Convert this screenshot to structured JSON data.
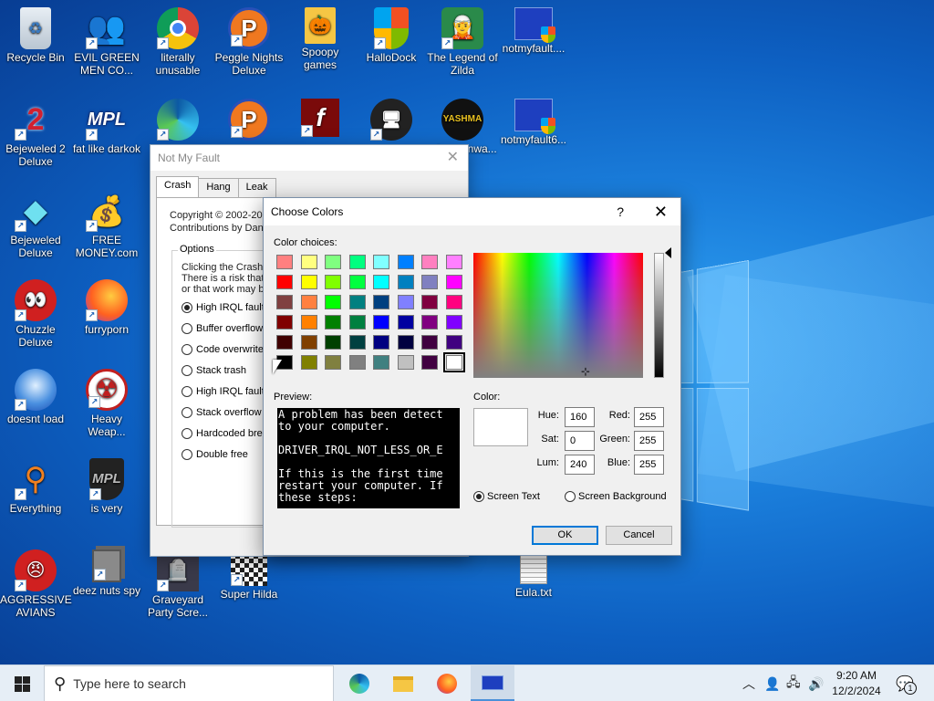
{
  "desktop": {
    "icons": [
      {
        "label": "Recycle Bin",
        "icon": "recycle-bin-icon"
      },
      {
        "label": "EVIL GREEN MEN CO...",
        "icon": "green-men-icon"
      },
      {
        "label": "literally unusable",
        "icon": "chrome-icon"
      },
      {
        "label": "Peggle Nights Deluxe",
        "icon": "peggle-icon"
      },
      {
        "label": "Spoopy games",
        "icon": "folder-icon"
      },
      {
        "label": "HalloDock",
        "icon": "shield-icon"
      },
      {
        "label": "The Legend of Zilda",
        "icon": "zelda-icon"
      },
      {
        "label": "notmyfault....",
        "icon": "notmyfault-icon"
      },
      {
        "label": "Bejeweled 2 Deluxe",
        "icon": "bejeweled2-icon"
      },
      {
        "label": "fat like darkok",
        "icon": "mpl-icon"
      },
      {
        "label": "",
        "icon": "edge-icon"
      },
      {
        "label": "",
        "icon": "peggle2-icon"
      },
      {
        "label": "",
        "icon": "flash-icon"
      },
      {
        "label": "",
        "icon": "hallodock2-icon"
      },
      {
        "label": "...boo ...nwa...",
        "icon": "yashma-icon"
      },
      {
        "label": "notmyfault6...",
        "icon": "notmyfault2-icon"
      },
      {
        "label": "Bejeweled Deluxe",
        "icon": "diamond-icon"
      },
      {
        "label": "FREE MONEY.com",
        "icon": "money-bag-icon"
      },
      {
        "label": "Chuzzle Deluxe",
        "icon": "chuzzle-icon"
      },
      {
        "label": "furryporn",
        "icon": "firefox-icon"
      },
      {
        "label": "doesnt load",
        "icon": "thunderbird-icon"
      },
      {
        "label": "Heavy Weap...",
        "icon": "radiation-icon"
      },
      {
        "label": "Everything",
        "icon": "everything-icon"
      },
      {
        "label": "is very",
        "icon": "mpl2-icon"
      },
      {
        "label": "AGGRESSIVE AVIANS",
        "icon": "angry-bird-icon"
      },
      {
        "label": "deez nuts spy",
        "icon": "cards-icon"
      },
      {
        "label": "Graveyard Party Scre...",
        "icon": "graveyard-icon"
      },
      {
        "label": "Super Hilda",
        "icon": "pixel-icon"
      },
      {
        "label": "Eula.txt",
        "icon": "text-file-icon"
      }
    ]
  },
  "notmyfault": {
    "title": "Not My Fault",
    "tabs": [
      "Crash",
      "Hang",
      "Leak"
    ],
    "copyright": "Copyright © 2002-20",
    "contributions": "Contributions by Dani",
    "options_legend": "Options",
    "desc": [
      "Clicking the Crash b",
      "There is a risk that c",
      "or that work may be"
    ],
    "radios": [
      "High IRQL fault (",
      "Buffer overflow",
      "Code overwrite",
      "Stack trash",
      "High IRQL fault (",
      "Stack overflow",
      "Hardcoded breal",
      "Double free"
    ]
  },
  "choose_colors": {
    "title": "Choose Colors",
    "help": "?",
    "color_choices_label": "Color choices:",
    "preview_label": "Preview:",
    "preview_text": "A problem has been detect\nto your computer.\n\nDRIVER_IRQL_NOT_LESS_OR_E\n\nIf this is the first time\nrestart your computer. If\nthese steps:",
    "color_label": "Color:",
    "hue_label": "Hue:",
    "hue": "160",
    "sat_label": "Sat:",
    "sat": "0",
    "lum_label": "Lum:",
    "lum": "240",
    "red_label": "Red:",
    "red": "255",
    "green_label": "Green:",
    "green": "255",
    "blue_label": "Blue:",
    "blue": "255",
    "screen_text_label": "Screen Text",
    "screen_background_label": "Screen Background",
    "ok_label": "OK",
    "cancel_label": "Cancel",
    "swatches": [
      "#ff8080",
      "#ffff80",
      "#80ff80",
      "#00ff80",
      "#80ffff",
      "#0080ff",
      "#ff80c0",
      "#ff80ff",
      "#ff0000",
      "#ffff00",
      "#80ff00",
      "#00ff40",
      "#00ffff",
      "#0080c0",
      "#8080c0",
      "#ff00ff",
      "#804040",
      "#ff8040",
      "#00ff00",
      "#008080",
      "#004080",
      "#8080ff",
      "#800040",
      "#ff0080",
      "#800000",
      "#ff8000",
      "#008000",
      "#008040",
      "#0000ff",
      "#0000a0",
      "#800080",
      "#8000ff",
      "#400000",
      "#804000",
      "#004000",
      "#004040",
      "#000080",
      "#000040",
      "#400040",
      "#400080",
      "#000000",
      "#808000",
      "#808040",
      "#808080",
      "#408080",
      "#c0c0c0",
      "#400040",
      "#ffffff"
    ]
  },
  "taskbar": {
    "search_placeholder": "Type here to search",
    "time": "9:20 AM",
    "date": "12/2/2024",
    "notification_count": "1"
  }
}
